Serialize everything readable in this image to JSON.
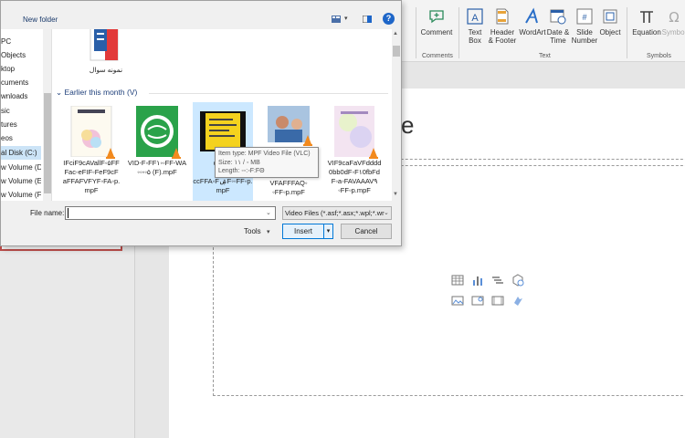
{
  "ribbon": {
    "buttons": [
      {
        "label": "Comment"
      },
      {
        "label": "Text\nBox"
      },
      {
        "label": "Header\n& Footer"
      },
      {
        "label": "WordArt"
      },
      {
        "label": "Date &\nTime"
      },
      {
        "label": "Slide\nNumber"
      },
      {
        "label": "Object"
      },
      {
        "label": "Equation"
      },
      {
        "label": "Symbol"
      }
    ],
    "groups": {
      "comments": "Comments",
      "text": "Text",
      "symbols": "Symbols"
    }
  },
  "dialog": {
    "new_folder": "New folder",
    "help": "?",
    "nav_items": [
      {
        "label": "PC"
      },
      {
        "label": "Objects"
      },
      {
        "label": "ktop"
      },
      {
        "label": "cuments"
      },
      {
        "label": "wnloads"
      },
      {
        "label": "sic"
      },
      {
        "label": "tures"
      },
      {
        "label": "eos"
      },
      {
        "label": "al Disk (C:)"
      },
      {
        "label": "w Volume (D:"
      },
      {
        "label": "w Volume (E:)"
      },
      {
        "label": "w Volume (F:)"
      }
    ],
    "top_item": {
      "label": "نمونه سوال"
    },
    "group_header": "Earlier this month (V)",
    "files": [
      {
        "name": "IFciF9cAVallF◦۵FF\nFac◦eFIF◦FeF9cF\naFFAFVFYF◦FA◦p.\nmpF"
      },
      {
        "name": "VID-F◦FF۱◦◦FF-WA\n◦◦◦◦۵ (F).mpF"
      },
      {
        "name": "c9Fba\ndafid\nccFFA◦FۺF◦◦FF◦p.\nmpF"
      },
      {
        "name": "VFAFFFAQ◦\n◦FF◦p.mpF"
      },
      {
        "name": "VIF9caFaVFdddd\n0bb0dF◦F۱0fbFd\nF◦a◦FAVAAAV۹\n◦FF◦p.mpF"
      }
    ],
    "tooltip": {
      "type": "Item type: MPF Video File (VLC)",
      "size": "Size: ۱۱ / ◦ MB",
      "length": "Length: ◦◦:◦F:FΘ"
    },
    "file_name_label": "File name:",
    "file_name_value": "",
    "file_type": "Video Files (*.asf;*.asx;*.wpl;*.wr",
    "tools": "Tools",
    "insert": "Insert",
    "cancel": "Cancel"
  },
  "slide": {
    "title_glyph": "e"
  },
  "colors": {
    "accent": "#0078d7",
    "selection": "#cce8ff",
    "vlc": "#f28a1e",
    "help": "#1e66c8"
  }
}
